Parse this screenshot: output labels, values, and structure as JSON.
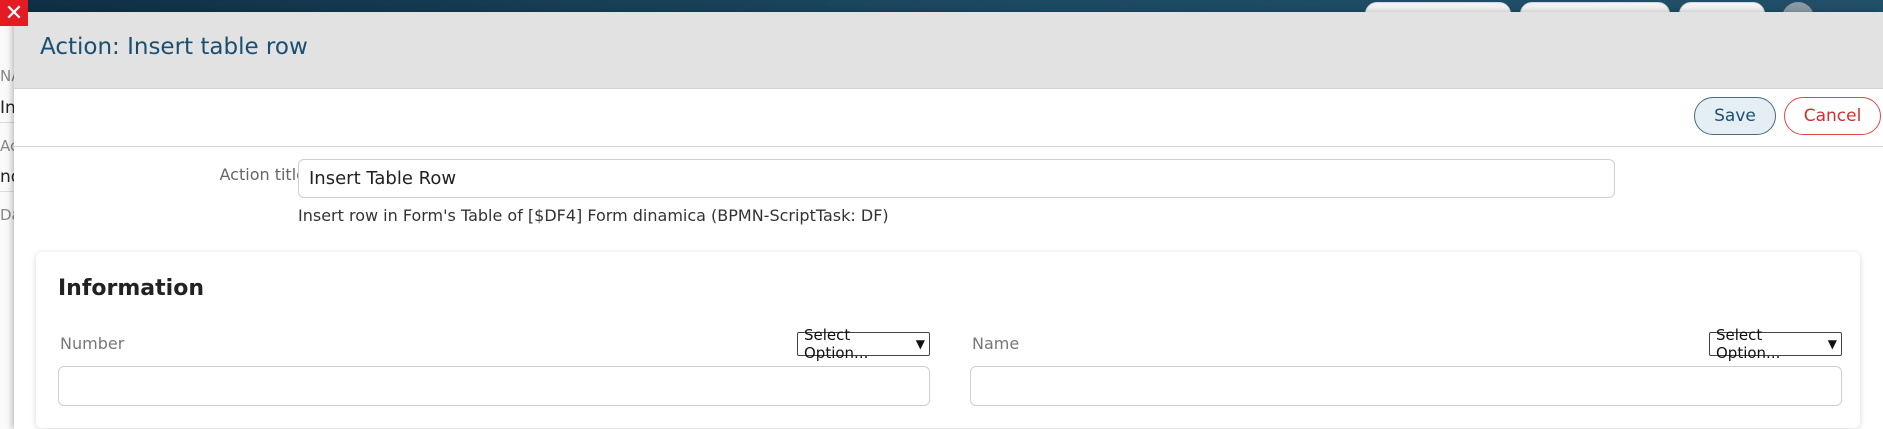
{
  "background": {
    "left_labels": [
      {
        "text": "NA",
        "style": "muted"
      },
      {
        "text": "In",
        "style": "strong"
      },
      {
        "text": "Ac",
        "style": "muted"
      },
      {
        "text": "nd",
        "style": "strong"
      },
      {
        "text": "Da",
        "style": "muted"
      }
    ]
  },
  "modal": {
    "title": "Action: Insert table row",
    "save_label": "Save",
    "cancel_label": "Cancel",
    "action_title_label": "Action title",
    "action_title_value": "Insert Table Row",
    "description": "Insert row in Form's Table of [$DF4] Form dinamica (BPMN-ScriptTask: DF)",
    "section_title": "Information",
    "fields": [
      {
        "label": "Number",
        "select_label": "Select Option...",
        "value": ""
      },
      {
        "label": "Name",
        "select_label": "Select Option...",
        "value": ""
      }
    ]
  },
  "colors": {
    "accent": "#1b4f72",
    "cancel": "#d32f2f",
    "close": "#e51b24"
  },
  "icons": {
    "close": "close-icon",
    "dropdown": "chevron-down-icon"
  }
}
